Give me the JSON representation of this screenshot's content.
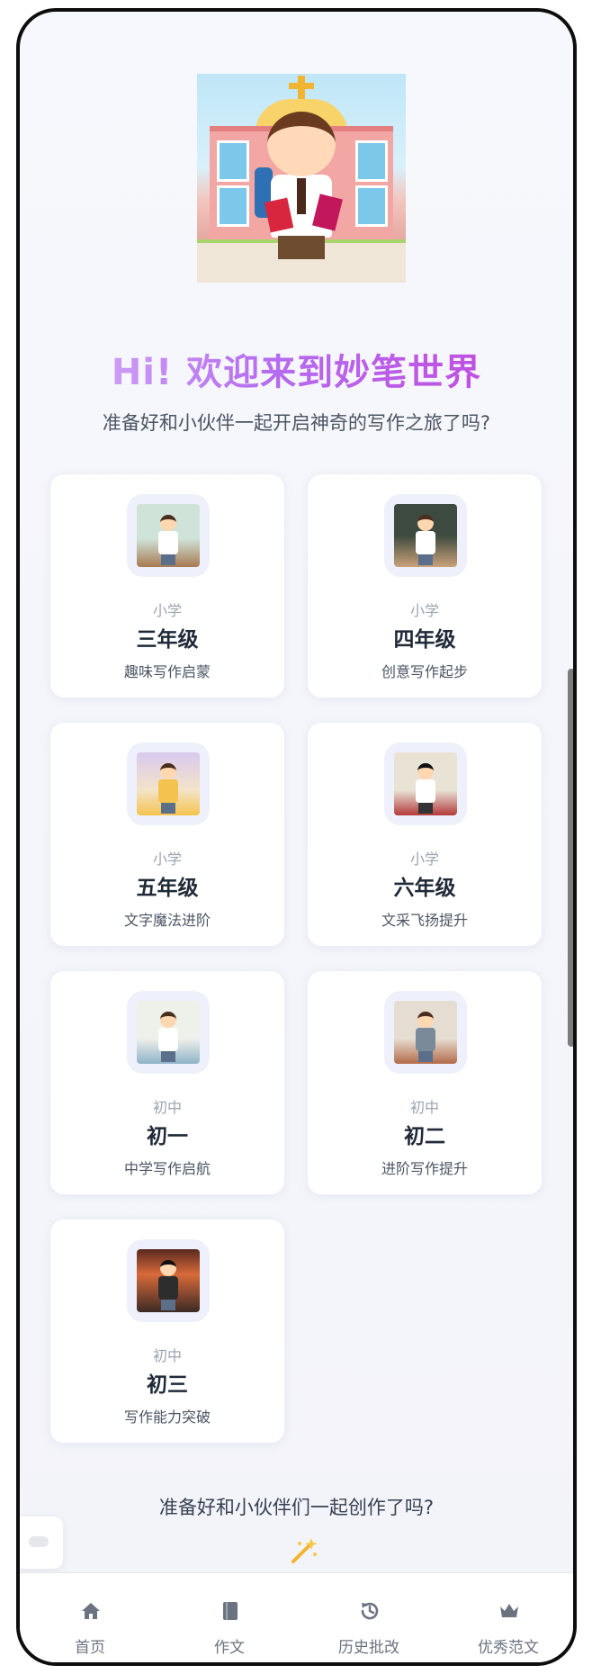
{
  "header": {
    "title": "Hi! 欢迎来到妙笔世界",
    "subtitle": "准备好和小伙伴一起开启神奇的写作之旅了吗?"
  },
  "grades": [
    {
      "level": "小学",
      "grade": "三年级",
      "desc": "趣味写作启蒙",
      "colors": [
        "#cfe3d8",
        "#7aa58f"
      ]
    },
    {
      "level": "小学",
      "grade": "四年级",
      "desc": "创意写作起步",
      "colors": [
        "#3d4a3f",
        "#c9a27a"
      ]
    },
    {
      "level": "小学",
      "grade": "五年级",
      "desc": "文字魔法进阶",
      "colors": [
        "#d9c9f0",
        "#f4c34e"
      ]
    },
    {
      "level": "小学",
      "grade": "六年级",
      "desc": "文采飞扬提升",
      "colors": [
        "#e9e3d6",
        "#b23a3a"
      ]
    },
    {
      "level": "初中",
      "grade": "初一",
      "desc": "中学写作启航",
      "colors": [
        "#eef0ea",
        "#8fb3c9"
      ]
    },
    {
      "level": "初中",
      "grade": "初二",
      "desc": "进阶写作提升",
      "colors": [
        "#e6ddd2",
        "#b36b4a"
      ]
    },
    {
      "level": "初中",
      "grade": "初三",
      "desc": "写作能力突破",
      "colors": [
        "#d86a3a",
        "#3b2a24"
      ]
    }
  ],
  "footer_prompt": "准备好和小伙伴们一起创作了吗?",
  "tabbar": [
    {
      "label": "首页",
      "icon": "home-icon"
    },
    {
      "label": "作文",
      "icon": "notebook-icon"
    },
    {
      "label": "历史批改",
      "icon": "history-icon"
    },
    {
      "label": "优秀范文",
      "icon": "crown-icon"
    }
  ]
}
